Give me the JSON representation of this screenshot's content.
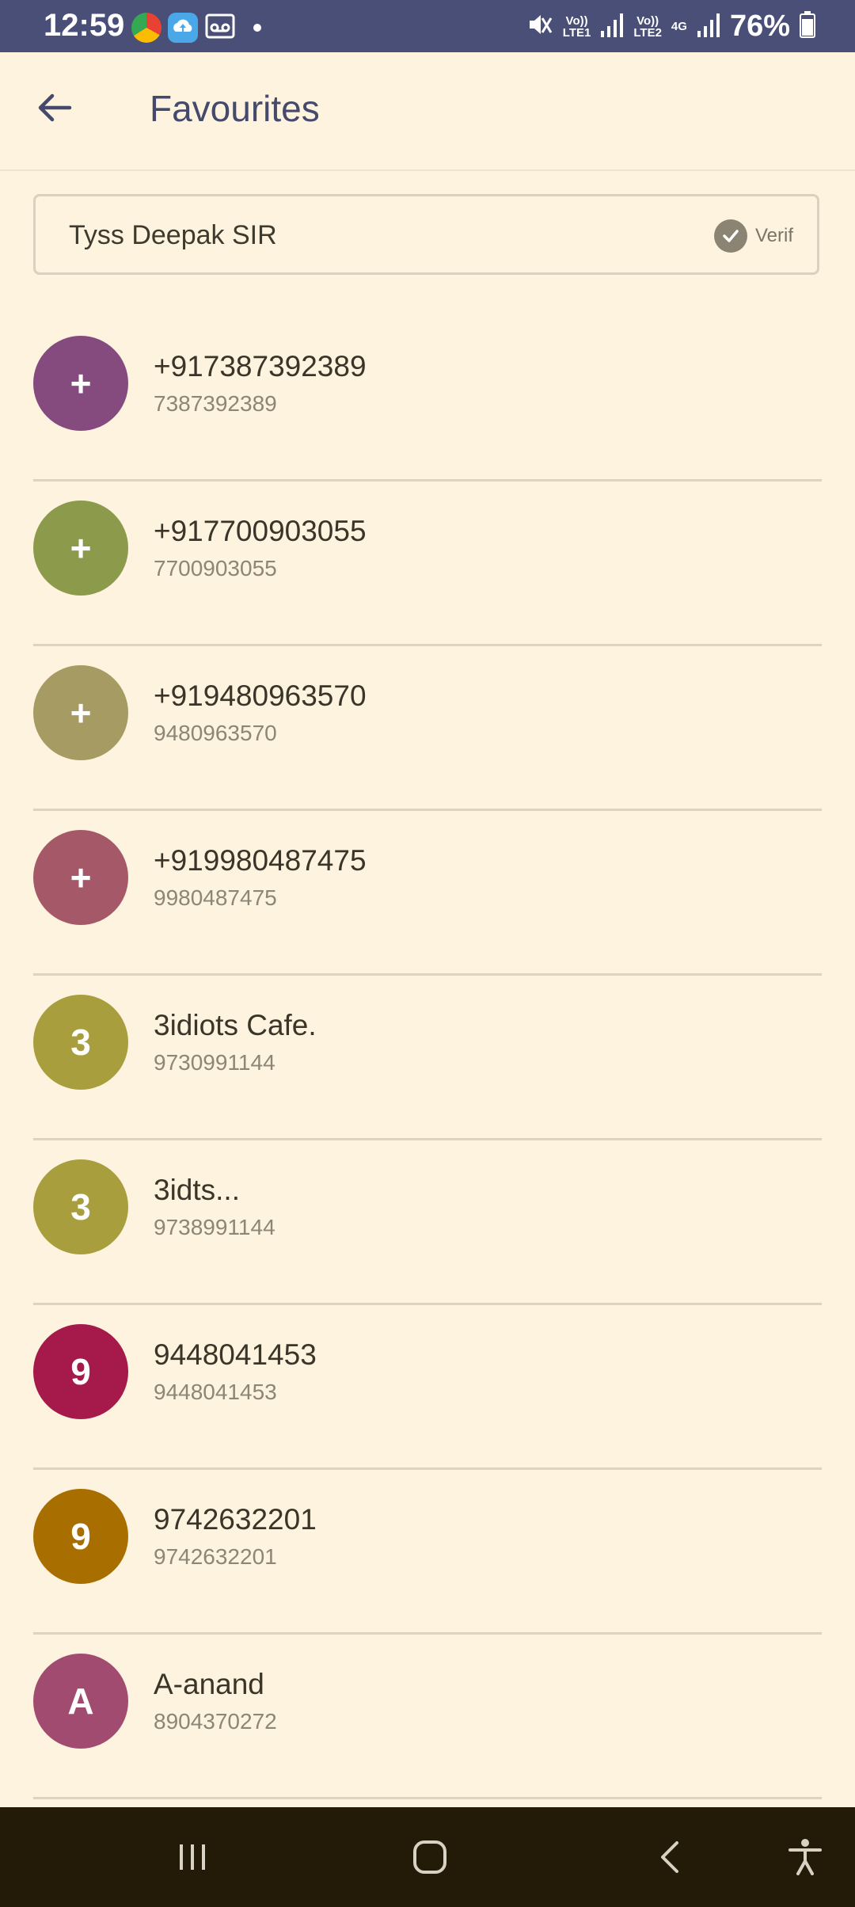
{
  "status_bar": {
    "time": "12:59",
    "battery": "76%",
    "sim1_label_top": "Vo))",
    "sim1_label_bottom": "LTE1",
    "sim2_label_top": "Vo))",
    "sim2_label_bottom": "LTE2",
    "network": "4G"
  },
  "header": {
    "title": "Favourites",
    "back_icon": "arrow-left-icon"
  },
  "search": {
    "value": "Tyss Deepak SIR",
    "verified_label": "Verif",
    "verified_icon": "check-circle-icon"
  },
  "contacts": [
    {
      "initial": "+",
      "name": "+917387392389",
      "number": "7387392389",
      "color": "#864b7e"
    },
    {
      "initial": "+",
      "name": "+917700903055",
      "number": "7700903055",
      "color": "#8c9a4c"
    },
    {
      "initial": "+",
      "name": "+919480963570",
      "number": "9480963570",
      "color": "#a59b63"
    },
    {
      "initial": "+",
      "name": "+919980487475",
      "number": "9980487475",
      "color": "#a55968"
    },
    {
      "initial": "3",
      "name": "3idiots Cafe.",
      "number": "9730991144",
      "color": "#a89e3e"
    },
    {
      "initial": "3",
      "name": "3idts...",
      "number": "9738991144",
      "color": "#a89e3e"
    },
    {
      "initial": "9",
      "name": "9448041453",
      "number": "9448041453",
      "color": "#a51a4a"
    },
    {
      "initial": "9",
      "name": "9742632201",
      "number": "9742632201",
      "color": "#a86f00"
    },
    {
      "initial": "A",
      "name": "A-anand",
      "number": "8904370272",
      "color": "#a04b6f"
    }
  ],
  "nav": {
    "recents_icon": "recents-icon",
    "home_icon": "home-icon",
    "back_icon": "back-icon",
    "accessibility_icon": "accessibility-icon"
  }
}
